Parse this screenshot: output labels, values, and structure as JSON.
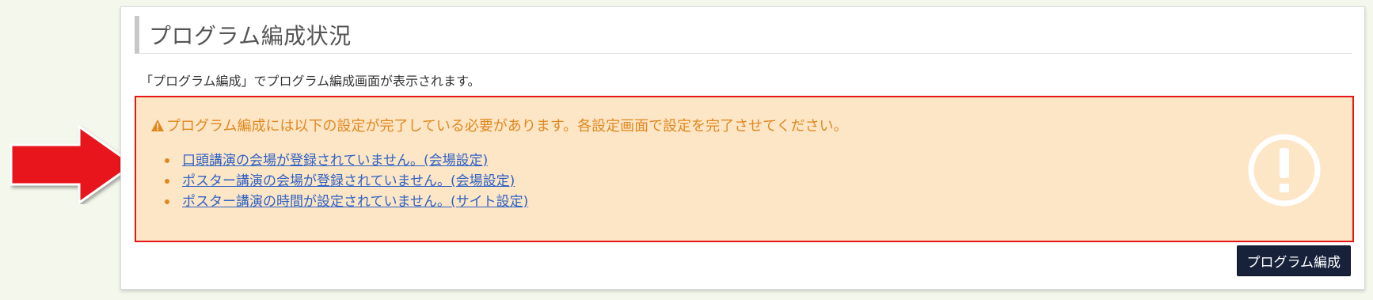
{
  "panel": {
    "title": "プログラム編成状況",
    "intro": "「プログラム編成」でプログラム編成画面が表示されます。"
  },
  "alert": {
    "heading": "プログラム編成には以下の設定が完了している必要があります。各設定画面で設定を完了させてください。",
    "items": [
      {
        "label": "口頭講演の会場が登録されていません。(会場設定)"
      },
      {
        "label": "ポスター講演の会場が登録されていません。(会場設定)"
      },
      {
        "label": "ポスター講演の時間が設定されていません。(サイト設定)"
      }
    ]
  },
  "actions": {
    "compose_button": "プログラム編成"
  },
  "colors": {
    "page_bg": "#f4f8ec",
    "alert_bg": "#fde6c6",
    "alert_border": "#e51616",
    "alert_text": "#e08820",
    "link": "#2f62c4",
    "button_bg": "#17223a",
    "arrow": "#e8141c"
  },
  "icons": {
    "heading": "warning-triangle-icon",
    "watermark": "exclamation-circle-icon",
    "annotation": "red-arrow-right-icon"
  }
}
